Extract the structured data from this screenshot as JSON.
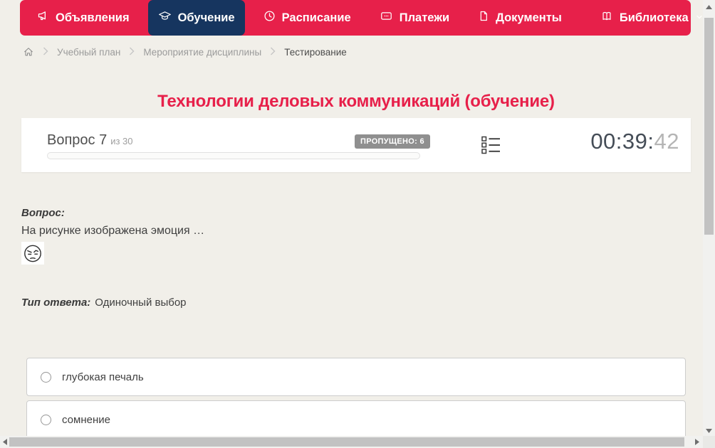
{
  "colors": {
    "accent_red": "#e7204a",
    "active_nav_navy": "#16355f",
    "page_bg": "#f1efe9",
    "badge_gray": "#8f8f8f",
    "timer_dark": "#454d57",
    "timer_light": "#b5b5b5"
  },
  "navbar": {
    "items": [
      {
        "label": "Объявления",
        "icon": "megaphone-icon",
        "active": false
      },
      {
        "label": "Обучение",
        "icon": "graduation-cap-icon",
        "active": true
      },
      {
        "label": "Расписание",
        "icon": "clock-icon",
        "active": false
      },
      {
        "label": "Платежи",
        "icon": "credit-card-icon",
        "active": false
      },
      {
        "label": "Документы",
        "icon": "document-icon",
        "active": false
      },
      {
        "label": "Библиотека",
        "icon": "book-icon",
        "active": false,
        "has_dropdown": true
      }
    ]
  },
  "breadcrumb": {
    "items": [
      "Учебный план",
      "Мероприятие дисциплины",
      "Тестирование"
    ]
  },
  "page": {
    "title": "Технологии деловых коммуникаций (обучение)"
  },
  "question_header": {
    "question_label": "Вопрос 7",
    "of_total": "из 30",
    "skipped_badge": "ПРОПУЩЕНО: 6",
    "progress_percent": 0,
    "timer": {
      "main": "00:39:",
      "seconds": "42"
    }
  },
  "question": {
    "label": "Вопрос:",
    "text": "На рисунке изображена эмоция …",
    "image": "skeptical-face-emoticon",
    "answer_type_label": "Тип ответа:",
    "answer_type_value": "Одиночный выбор"
  },
  "options": [
    {
      "label": "глубокая печаль",
      "selected": false
    },
    {
      "label": "сомнение",
      "selected": false
    }
  ]
}
